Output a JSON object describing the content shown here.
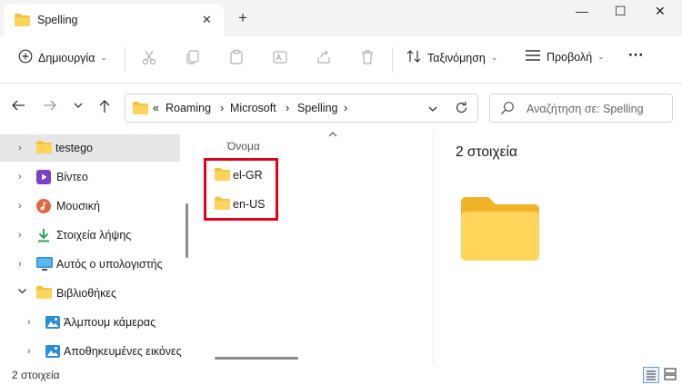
{
  "window": {
    "tab_title": "Spelling",
    "tab_close": "✕",
    "new_tab": "+",
    "minimize": "—",
    "maximize": "☐",
    "close": "✕"
  },
  "toolbar": {
    "new_label": "Δημιουργία",
    "sort_label": "Ταξινόμηση",
    "view_label": "Προβολή",
    "more": "···",
    "icons": [
      "plus-circle-icon",
      "cut-icon",
      "copy-icon",
      "paste-icon",
      "rename-icon",
      "share-icon",
      "delete-icon",
      "sort-icon",
      "view-icon",
      "more-icon"
    ]
  },
  "address": {
    "overflow": "«",
    "crumbs": [
      "Roaming",
      "Microsoft",
      "Spelling"
    ],
    "separator": "›"
  },
  "search": {
    "placeholder": "Αναζήτηση σε: Spelling"
  },
  "nav": {
    "items": [
      {
        "label": "testego",
        "icon": "folder-icon"
      },
      {
        "label": "Βίντεο",
        "icon": "video-icon"
      },
      {
        "label": "Μουσική",
        "icon": "music-icon"
      },
      {
        "label": "Στοιχεία λήψης",
        "icon": "download-icon"
      },
      {
        "label": "Αυτός ο υπολογιστής",
        "icon": "computer-icon"
      },
      {
        "label": "Βιβλιοθήκες",
        "icon": "folder-icon"
      },
      {
        "label": "Άλμπουμ κάμερας",
        "icon": "picture-icon"
      },
      {
        "label": "Αποθηκευμένες εικόνες",
        "icon": "picture-icon"
      }
    ]
  },
  "filelist": {
    "column_name": "Όνομα",
    "files": [
      {
        "name": "el-GR"
      },
      {
        "name": "en-US"
      }
    ]
  },
  "preview": {
    "count_text": "2 στοιχεία"
  },
  "status": {
    "count_text": "2 στοιχεία"
  },
  "colors": {
    "folder": "#f5c23c",
    "highlight": "#e0001a",
    "selected_row": "#e6e6e6"
  }
}
